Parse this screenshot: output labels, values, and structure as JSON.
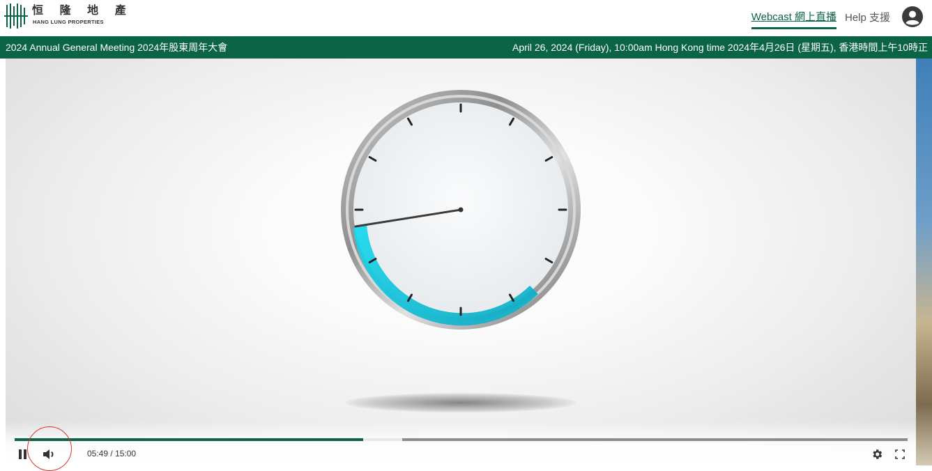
{
  "header": {
    "logo_chinese": "恒 隆 地 產",
    "logo_english": "Hang Lung Properties",
    "nav": {
      "webcast_label": "Webcast 網上直播",
      "help_label": "Help 支援"
    },
    "account_icon": "account-circle-icon"
  },
  "titlebar": {
    "event_title": "2024 Annual General Meeting 2024年股東周年大會",
    "event_datetime": "April 26, 2024 (Friday), 10:00am Hong Kong time 2024年4月26日 (星期五), 香港時間上午10時正"
  },
  "player": {
    "current_time": "05:49",
    "separator": "/",
    "duration": "15:00",
    "played_fraction": 0.39,
    "gap_end_fraction": 0.434,
    "icons": {
      "pause": "pause-icon",
      "volume": "volume-icon",
      "settings": "gear-icon",
      "fullscreen": "fullscreen-icon"
    }
  },
  "colors": {
    "brand_green": "#0b6446",
    "countdown_arc": "#1fd6e8",
    "annotation_circle": "#e03030"
  }
}
